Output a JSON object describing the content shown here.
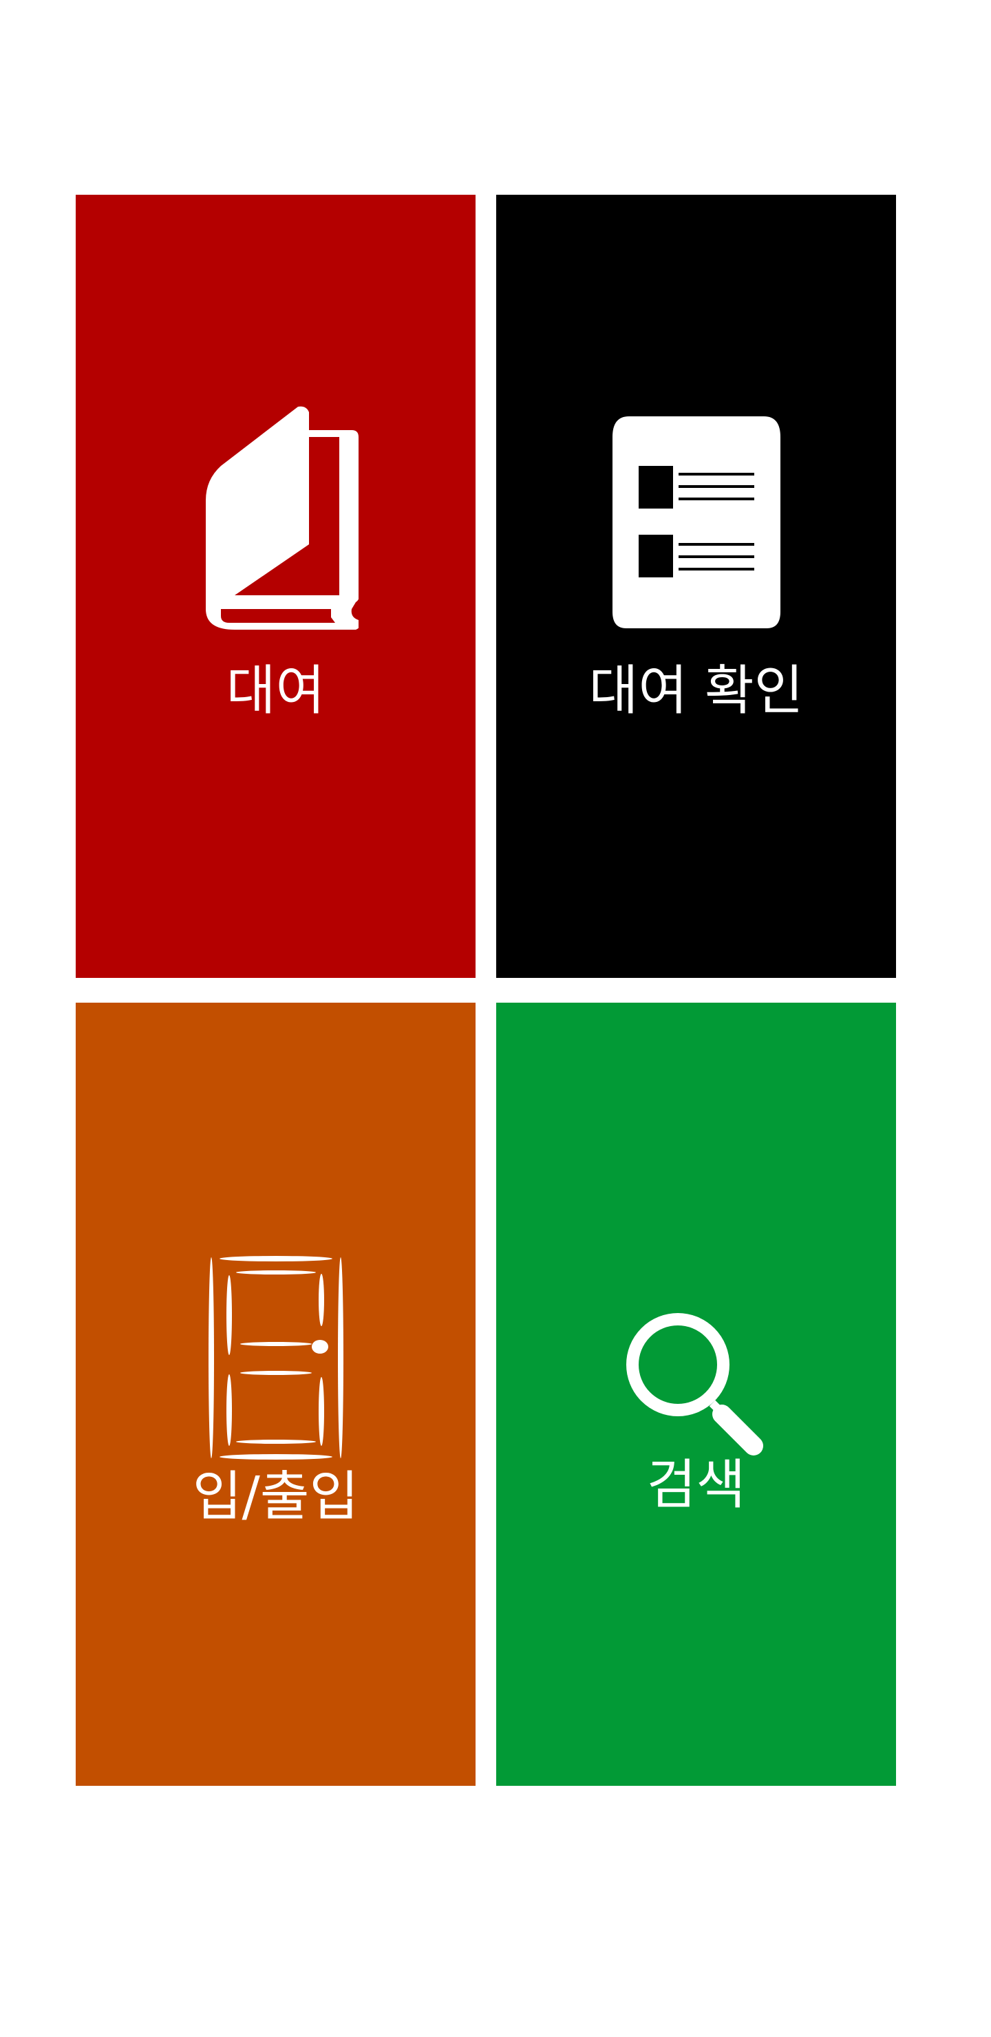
{
  "tiles": [
    {
      "id": "rent",
      "label": "대여",
      "color": "#b40000",
      "icon": "book-icon"
    },
    {
      "id": "check",
      "label": "대여 확인",
      "color": "#000000",
      "icon": "document-list-icon"
    },
    {
      "id": "entry",
      "label": "입/출입",
      "color": "#c24f00",
      "icon": "door-icon"
    },
    {
      "id": "search",
      "label": "검색",
      "color": "#029a36",
      "icon": "magnifier-icon"
    }
  ],
  "colors": {
    "background": "#ffffff",
    "icon_fill": "#ffffff"
  }
}
